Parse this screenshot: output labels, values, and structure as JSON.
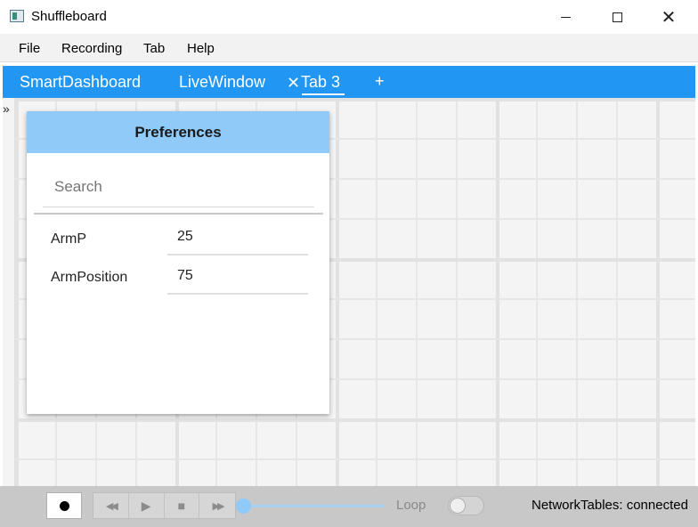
{
  "window": {
    "title": "Shuffleboard",
    "minimize_icon": "minimize-icon",
    "maximize_icon": "maximize-icon",
    "close_glyph": "✕"
  },
  "menu": {
    "items": [
      {
        "label": "File"
      },
      {
        "label": "Recording"
      },
      {
        "label": "Tab"
      },
      {
        "label": "Help"
      }
    ]
  },
  "tabs": {
    "items": [
      {
        "label": "SmartDashboard"
      },
      {
        "label": "LiveWindow"
      },
      {
        "label": "Tab 3"
      }
    ],
    "close_glyph": "✕",
    "add_glyph": "+",
    "active_index": 2,
    "accent": "#2196f3"
  },
  "workspace": {
    "expand_glyph": "»"
  },
  "widget": {
    "title": "Preferences",
    "header_color": "#90caf9",
    "search_placeholder": "Search",
    "rows": [
      {
        "label": "ArmP",
        "value": "25"
      },
      {
        "label": "ArmPosition",
        "value": "75"
      }
    ]
  },
  "bottom": {
    "record_icon": "record-icon",
    "playback_glyphs": {
      "rewind": "◀◀",
      "play": "▶",
      "stop": "■",
      "fast_forward": "▶▶"
    },
    "loop_label": "Loop",
    "loop_enabled": false,
    "progress": 0,
    "status": "NetworkTables: connected"
  }
}
